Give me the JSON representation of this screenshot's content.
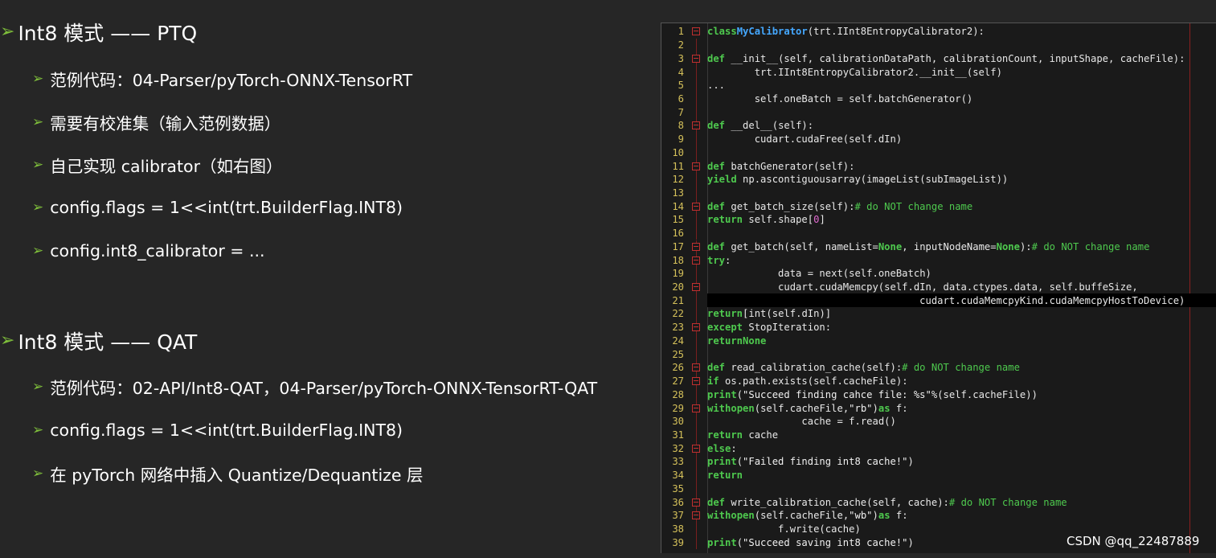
{
  "colors": {
    "background": "#262626",
    "accent_arrow": "#7fbf3b",
    "code_bg": "#1a1a1a",
    "keyword": "#4ec94e",
    "class_name": "#45a8ff",
    "comment": "#4ec94e",
    "string": "#f0f0f0",
    "line_number": "#d4c05a",
    "fold_marker": "#c03030"
  },
  "icons": {
    "bullet": "arrow-right-icon",
    "fold": "fold-marker-icon"
  },
  "sections": [
    {
      "heading": "Int8 模式 —— PTQ",
      "items": [
        "范例代码：04-Parser/pyTorch-ONNX-TensorRT",
        "需要有校准集（输入范例数据）",
        "自己实现 calibrator（如右图）",
        "config.flags = 1<<int(trt.BuilderFlag.INT8)",
        "config.int8_calibrator = ..."
      ]
    },
    {
      "heading": "Int8 模式 —— QAT",
      "items": [
        "范例代码：02-API/Int8-QAT，04-Parser/pyTorch-ONNX-TensorRT-QAT",
        "config.flags = 1<<int(trt.BuilderFlag.INT8)",
        "在 pyTorch 网络中插入 Quantize/Dequantize 层"
      ]
    }
  ],
  "code": {
    "lines": [
      "class MyCalibrator(trt.IInt8EntropyCalibrator2):",
      "",
      "    def __init__(self, calibrationDataPath, calibrationCount, inputShape, cacheFile):",
      "        trt.IInt8EntropyCalibrator2.__init__(self)",
      "        ...",
      "        self.oneBatch = self.batchGenerator()",
      "",
      "    def __del__(self):",
      "        cudart.cudaFree(self.dIn)",
      "",
      "    def batchGenerator(self):",
      "        yield np.ascontiguousarray(imageList(subImageList))",
      "",
      "    def get_batch_size(self):  # do NOT change name",
      "        return self.shape[0]",
      "",
      "    def get_batch(self, nameList=None, inputNodeName=None):  # do NOT change name",
      "        try:",
      "            data = next(self.oneBatch)",
      "            cudart.cudaMemcpy(self.dIn, data.ctypes.data, self.buffeSize,",
      "                                    cudart.cudaMemcpyKind.cudaMemcpyHostToDevice)",
      "            return [int(self.dIn)]",
      "        except StopIteration:",
      "            return None",
      "",
      "    def read_calibration_cache(self):  # do NOT change name",
      "        if os.path.exists(self.cacheFile):",
      "            print(\"Succeed finding cahce file: %s\" % (self.cacheFile))",
      "            with open(self.cacheFile, \"rb\") as f:",
      "                cache = f.read()",
      "                return cache",
      "        else:",
      "            print(\"Failed finding int8 cache!\")",
      "            return",
      "",
      "    def write_calibration_cache(self, cache):  # do NOT change name",
      "        with open(self.cacheFile, \"wb\") as f:",
      "            f.write(cache)",
      "        print(\"Succeed saving int8 cache!\")"
    ],
    "line_numbers": [
      "1",
      "2",
      "3",
      "4",
      "5",
      "6",
      "7",
      "8",
      "9",
      "10",
      "11",
      "12",
      "13",
      "14",
      "15",
      "16",
      "17",
      "18",
      "19",
      "20",
      "21",
      "22",
      "23",
      "24",
      "25",
      "26",
      "27",
      "28",
      "29",
      "30",
      "31",
      "32",
      "33",
      "34",
      "35",
      "36",
      "37",
      "38",
      "39"
    ],
    "fold_markers": [
      1,
      3,
      8,
      11,
      14,
      17,
      18,
      20,
      23,
      26,
      27,
      29,
      32,
      36,
      37
    ],
    "highlighted_line": 21
  },
  "watermark": "CSDN @qq_22487889"
}
